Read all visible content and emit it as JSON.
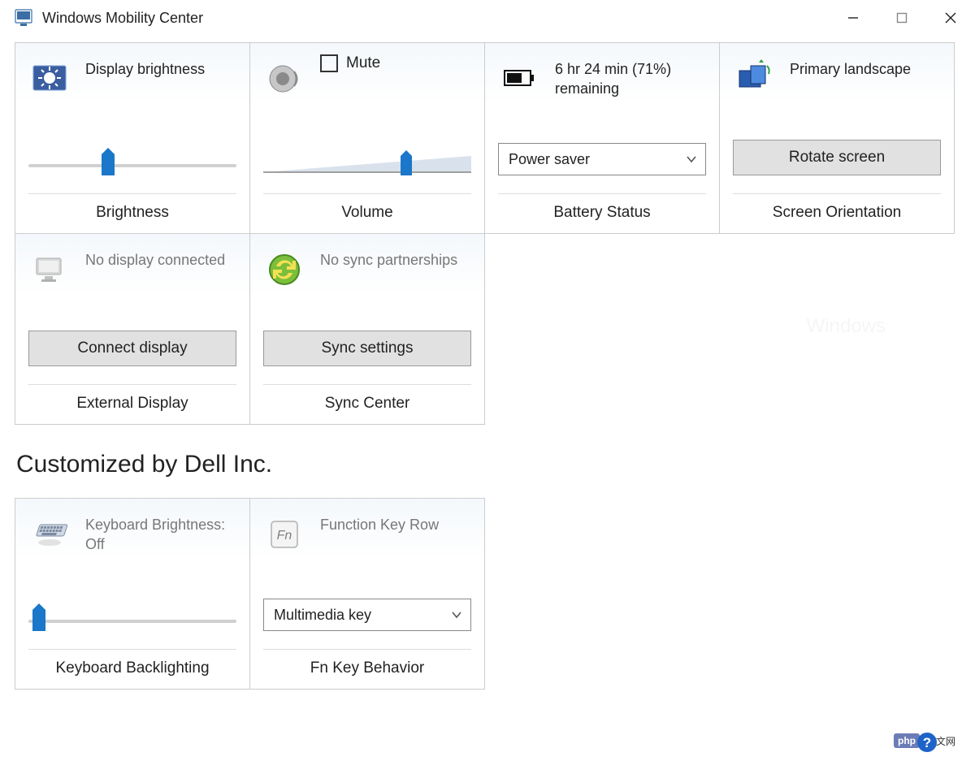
{
  "window": {
    "title": "Windows Mobility Center"
  },
  "tiles": {
    "brightness": {
      "label": "Display brightness",
      "footer": "Brightness",
      "slider_percent": 35
    },
    "volume": {
      "mute_label": "Mute",
      "footer": "Volume",
      "slider_percent": 68
    },
    "battery": {
      "status_text": "6 hr 24 min (71%) remaining",
      "plan_selected": "Power saver",
      "footer": "Battery Status"
    },
    "orientation": {
      "label": "Primary landscape",
      "button": "Rotate screen",
      "footer": "Screen Orientation"
    },
    "external_display": {
      "label": "No display connected",
      "button": "Connect display",
      "footer": "External Display"
    },
    "sync": {
      "label": "No sync partnerships",
      "button": "Sync settings",
      "footer": "Sync Center"
    }
  },
  "custom_section": {
    "title": "Customized by Dell Inc.",
    "keyboard_backlight": {
      "label": "Keyboard Brightness: Off",
      "footer": "Keyboard Backlighting",
      "slider_percent": 4
    },
    "fn_key": {
      "label": "Function Key Row",
      "selected": "Multimedia key",
      "footer": "Fn Key Behavior"
    }
  },
  "watermark": "Windows",
  "badge": {
    "php": "php",
    "cn": "中文网"
  }
}
